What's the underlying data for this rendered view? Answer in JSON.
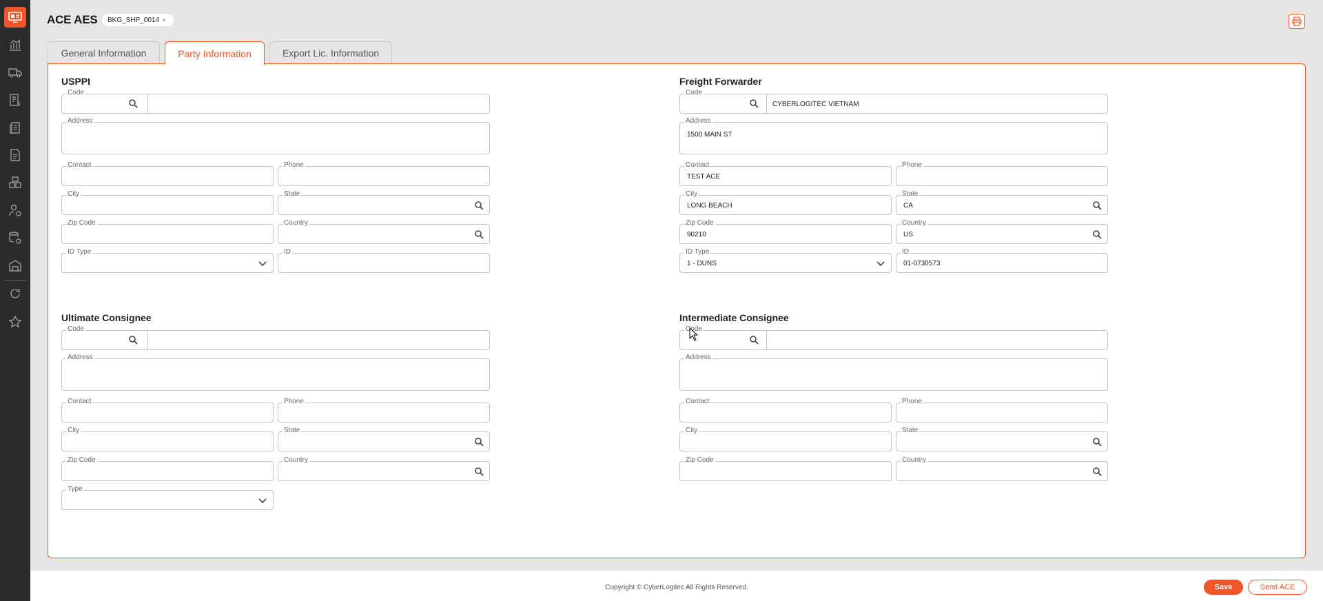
{
  "app": {
    "title": "ACE AES",
    "booking_id": "BKG_SHP_0014"
  },
  "tabs": [
    {
      "label": "General Information"
    },
    {
      "label": "Party Information"
    },
    {
      "label": "Export Lic. Information"
    }
  ],
  "active_tab": "Party Information",
  "labels": {
    "code": "Code",
    "address": "Address",
    "contact": "Contact",
    "phone": "Phone",
    "city": "City",
    "state": "State",
    "zip": "Zip Code",
    "country": "Country",
    "id_type": "ID Type",
    "id": "ID",
    "type": "Type"
  },
  "usppi": {
    "title": "USPPI",
    "code": "",
    "name": "",
    "address": "",
    "contact": "",
    "phone": "",
    "city": "",
    "state": "",
    "zip": "",
    "country": "",
    "id_type": "",
    "id": ""
  },
  "freight_forwarder": {
    "title": "Freight Forwarder",
    "code": "",
    "name": "CYBERLOGITEC VIETNAM",
    "address": "1500 MAIN ST",
    "contact": "TEST ACE",
    "phone": "",
    "city": "LONG BEACH",
    "state": "CA",
    "zip": "90210",
    "country": "US",
    "id_type": "1 - DUNS",
    "id": "01-0730573"
  },
  "ultimate_consignee": {
    "title": "Ultimate Consignee",
    "code": "",
    "name": "",
    "address": "",
    "contact": "",
    "phone": "",
    "city": "",
    "state": "",
    "zip": "",
    "country": "",
    "type": ""
  },
  "intermediate_consignee": {
    "title": "Intermediate Consignee",
    "code": "",
    "name": "",
    "address": "",
    "contact": "",
    "phone": "",
    "city": "",
    "state": "",
    "zip": "",
    "country": ""
  },
  "footer": {
    "copyright": "Copyright © CyberLogitec All Rights Reserved."
  },
  "actions": {
    "save": "Save",
    "send": "Send ACE"
  },
  "colors": {
    "accent": "#f0562a",
    "sidebar": "#2b2b2b",
    "background": "#e6e6e6"
  },
  "sidebar_icons": [
    "dashboard-icon",
    "chart-icon",
    "truck-icon",
    "invoice-icon",
    "documents-icon",
    "report-icon",
    "boxes-icon",
    "user-settings-icon",
    "database-settings-icon",
    "warehouse-icon",
    "history-icon",
    "star-icon"
  ]
}
